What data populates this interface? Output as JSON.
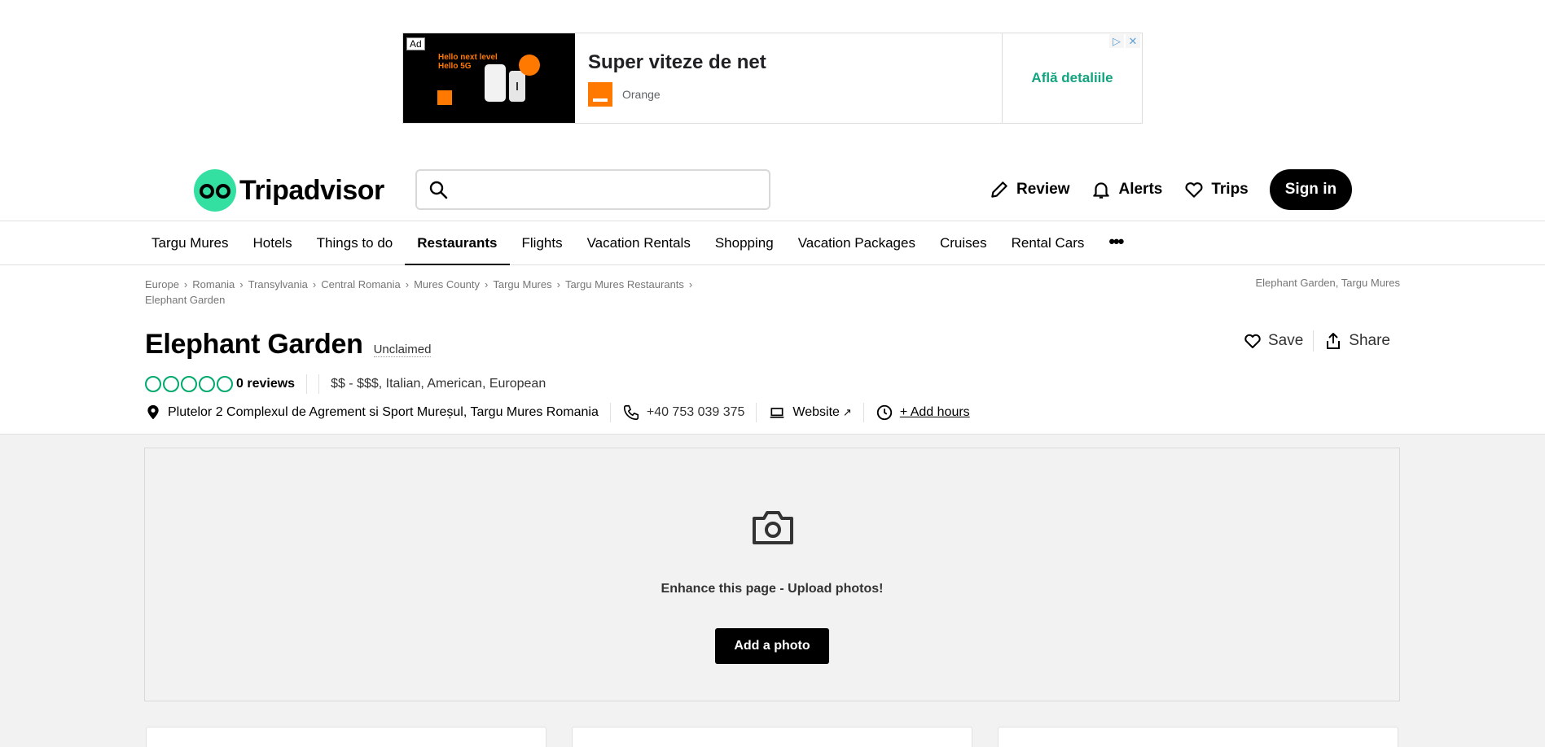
{
  "ad": {
    "badge": "Ad",
    "image_text": "Hello next level\nHello 5G",
    "headline": "Super viteze de net",
    "brand": "Orange",
    "cta": "Află detaliile",
    "choices_icons": [
      "adchoices-icon",
      "close-icon"
    ]
  },
  "header": {
    "logo_text": "Tripadvisor",
    "search_placeholder": "",
    "actions": [
      {
        "label": "Review",
        "icon": "pencil-icon"
      },
      {
        "label": "Alerts",
        "icon": "bell-icon"
      },
      {
        "label": "Trips",
        "icon": "heart-icon"
      }
    ],
    "signin_label": "Sign in"
  },
  "nav": {
    "items": [
      {
        "label": "Targu Mures"
      },
      {
        "label": "Hotels"
      },
      {
        "label": "Things to do"
      },
      {
        "label": "Restaurants",
        "active": true
      },
      {
        "label": "Flights"
      },
      {
        "label": "Vacation Rentals"
      },
      {
        "label": "Shopping"
      },
      {
        "label": "Vacation Packages"
      },
      {
        "label": "Cruises"
      },
      {
        "label": "Rental Cars"
      }
    ],
    "more_label": "•••"
  },
  "breadcrumb": {
    "items": [
      "Europe",
      "Romania",
      "Transylvania",
      "Central Romania",
      "Mures County",
      "Targu Mures",
      "Targu Mures Restaurants",
      "Elephant Garden"
    ],
    "right_text": "Elephant Garden, Targu Mures"
  },
  "restaurant": {
    "name": "Elephant Garden",
    "claim_status": "Unclaimed",
    "rating_bubbles": 0,
    "reviews_label": "0 reviews",
    "cuisine": "$$ - $$$, Italian, American, European",
    "address": "Plutelor 2 Complexul de Agrement si Sport Mureșul, Targu Mures Romania",
    "phone": "+40 753 039 375",
    "website_label": "Website",
    "hours_label": "+ Add hours",
    "save_label": "Save",
    "share_label": "Share"
  },
  "photos": {
    "prompt": "Enhance this page - Upload photos!",
    "button_label": "Add a photo"
  },
  "colors": {
    "brand_green": "#34e0a1",
    "bubble_green": "#00aa6c",
    "orange": "#ff7900",
    "cta_green": "#12a37f"
  }
}
